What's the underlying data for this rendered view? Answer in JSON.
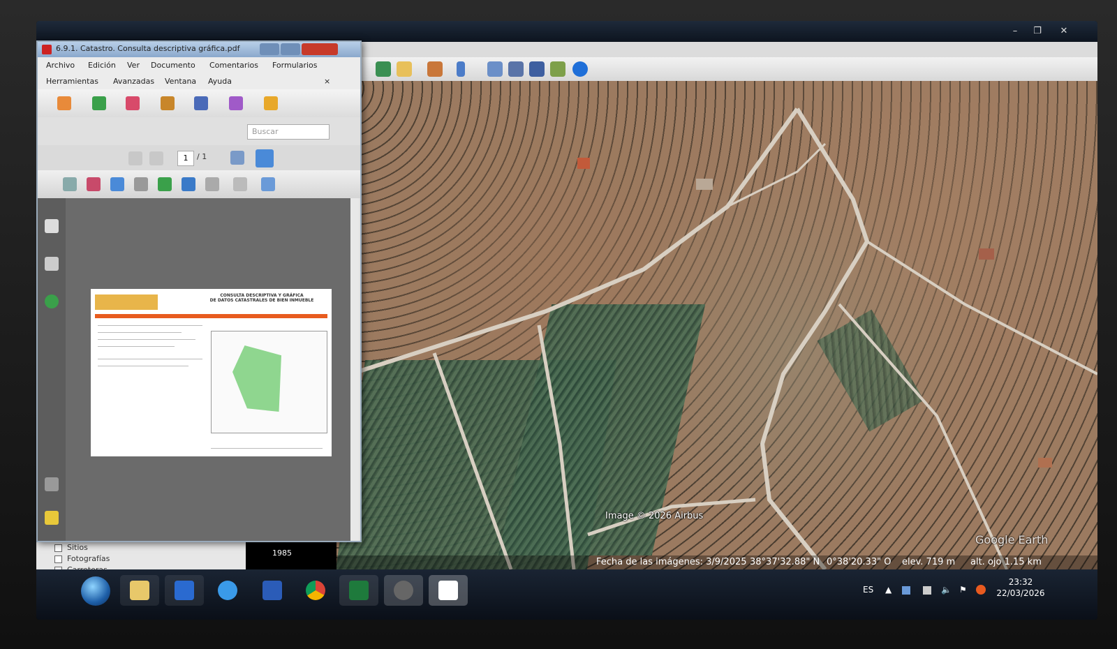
{
  "pdf_window": {
    "title": "6.9.1. Catastro. Consulta descriptiva gráfica.pdf",
    "menu": {
      "archivo": "Archivo",
      "edicion": "Edición",
      "ver": "Ver",
      "documento": "Documento",
      "comentarios": "Comentarios",
      "formularios": "Formularios",
      "herramientas": "Herramientas",
      "avanzadas": "Avanzadas",
      "ventana": "Ventana",
      "ayuda": "Ayuda",
      "close_x": "×"
    },
    "search_placeholder": "Buscar",
    "page_current": "1",
    "page_total": "/ 1",
    "doc_title_line1": "CONSULTA DESCRIPTIVA Y GRÁFICA",
    "doc_title_line2": "DE DATOS CATASTRALES DE BIEN INMUEBLE"
  },
  "ge_window": {
    "buttons": {
      "minimize": "–",
      "restore": "❐",
      "close": "✕"
    }
  },
  "sidebar": {
    "items": [
      {
        "label": "Sitios"
      },
      {
        "label": "Fotografías"
      },
      {
        "label": "Carreteras"
      }
    ],
    "count": "1985"
  },
  "map": {
    "credit": "Image © 2026 Airbus",
    "logo": "Google Earth"
  },
  "status": {
    "image_date": "Fecha de las imágenes: 3/9/2025",
    "lat": "38°37'32.88\" N",
    "lon": "0°38'20.33\" O",
    "elev": "elev.   719 m",
    "eye_alt": "alt. ojo   1.15 km"
  },
  "taskbar": {
    "lang": "ES",
    "time": "23:32",
    "date": "22/03/2026",
    "apps": [
      "explorer",
      "outlook",
      "internet-explorer",
      "word",
      "chrome",
      "excel",
      "google-earth",
      "acrobat"
    ]
  },
  "colors": {
    "acrobat_red": "#c22222",
    "excel_green": "#1e7a3c",
    "word_blue": "#2b5cb8",
    "parcel_green": "#8fd68f"
  }
}
